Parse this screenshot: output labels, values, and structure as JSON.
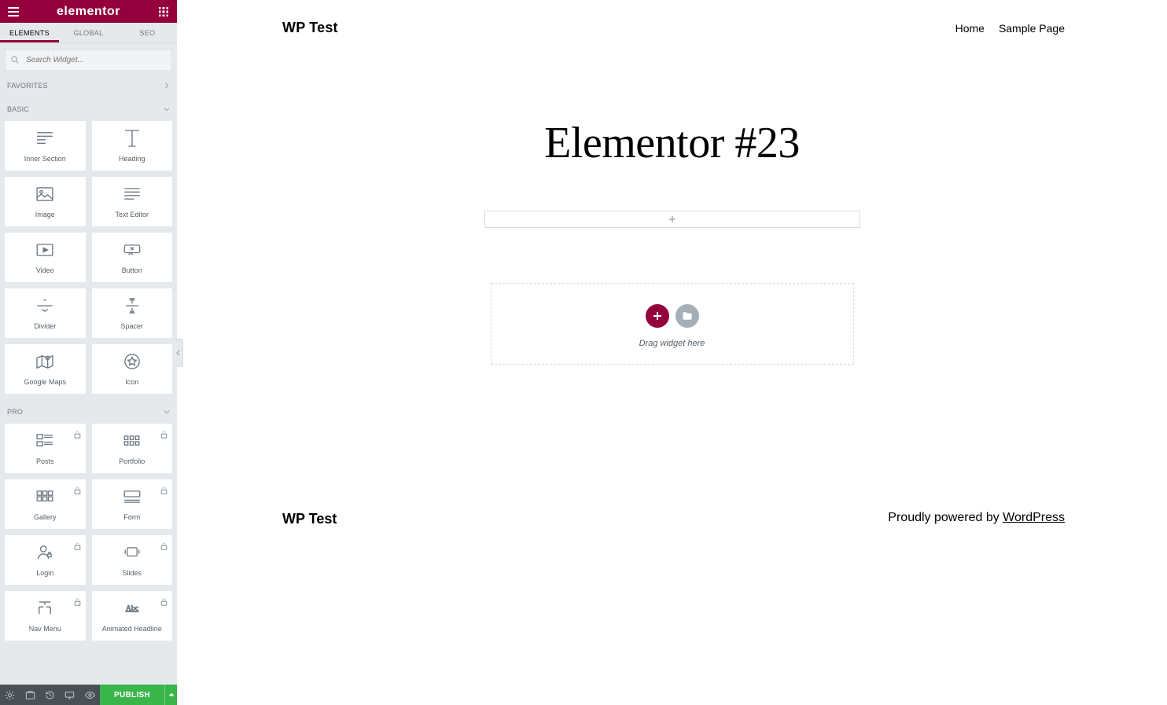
{
  "header": {
    "logo": "elementor"
  },
  "tabs": [
    {
      "label": "ELEMENTS",
      "active": true
    },
    {
      "label": "GLOBAL",
      "active": false
    },
    {
      "label": "SEO",
      "active": false
    }
  ],
  "search": {
    "placeholder": "Search Widget..."
  },
  "sections": {
    "favorites": {
      "title": "FAVORITES"
    },
    "basic": {
      "title": "BASIC",
      "widgets": [
        {
          "name": "inner-section",
          "label": "Inner Section"
        },
        {
          "name": "heading",
          "label": "Heading"
        },
        {
          "name": "image",
          "label": "Image"
        },
        {
          "name": "text-editor",
          "label": "Text Editor"
        },
        {
          "name": "video",
          "label": "Video"
        },
        {
          "name": "button",
          "label": "Button"
        },
        {
          "name": "divider",
          "label": "Divider"
        },
        {
          "name": "spacer",
          "label": "Spacer"
        },
        {
          "name": "google-maps",
          "label": "Google Maps"
        },
        {
          "name": "icon",
          "label": "Icon"
        }
      ]
    },
    "pro": {
      "title": "PRO",
      "widgets": [
        {
          "name": "posts",
          "label": "Posts",
          "locked": true
        },
        {
          "name": "portfolio",
          "label": "Portfolio",
          "locked": true
        },
        {
          "name": "gallery",
          "label": "Gallery",
          "locked": true
        },
        {
          "name": "form",
          "label": "Form",
          "locked": true
        },
        {
          "name": "login",
          "label": "Login",
          "locked": true
        },
        {
          "name": "slides",
          "label": "Slides",
          "locked": true
        },
        {
          "name": "nav-menu",
          "label": "Nav Menu",
          "locked": true
        },
        {
          "name": "animated-headline",
          "label": "Animated Headline",
          "locked": true
        }
      ]
    }
  },
  "bottom": {
    "publish": "PUBLISH"
  },
  "preview": {
    "site_title": "WP Test",
    "nav": [
      "Home",
      "Sample Page"
    ],
    "page_heading": "Elementor #23",
    "drop_label": "Drag widget here",
    "footer": {
      "left": "WP Test",
      "powered_by_text": "Proudly powered by ",
      "powered_by_link": "WordPress"
    }
  }
}
